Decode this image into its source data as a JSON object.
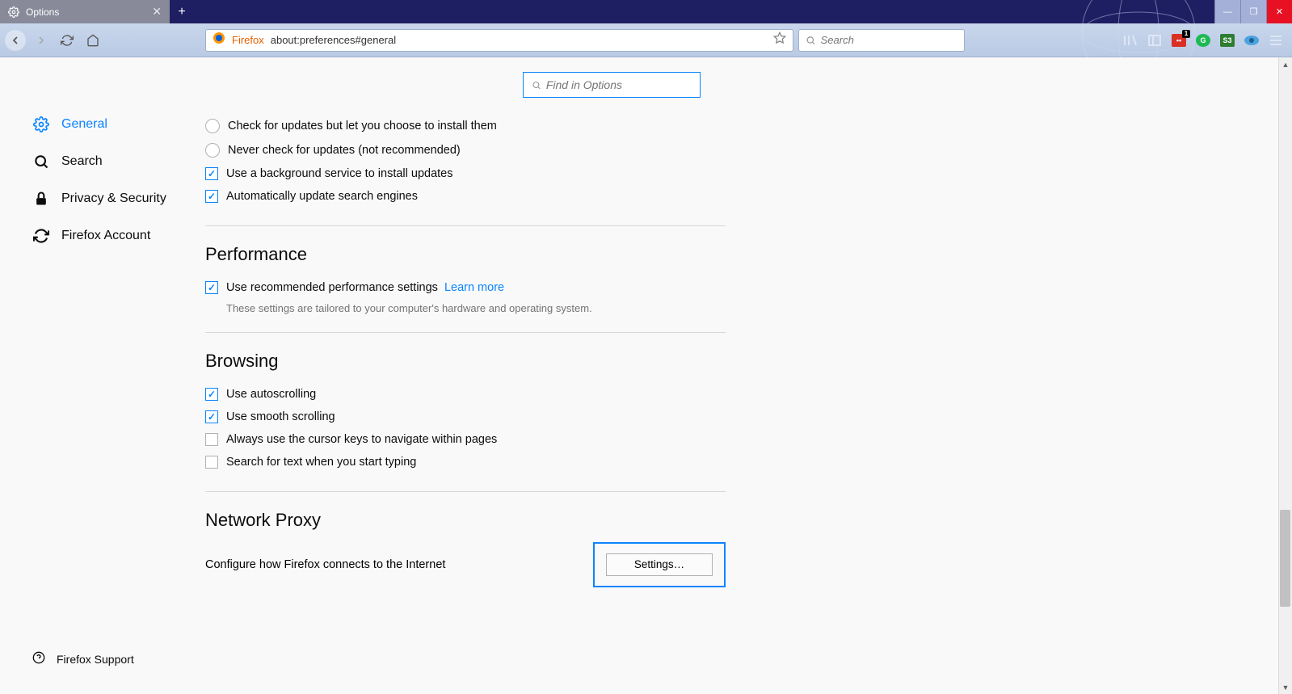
{
  "window": {
    "tab_title": "Options",
    "newtab_badge": "+"
  },
  "toolbar": {
    "firefox_label": "Firefox",
    "url": "about:preferences#general",
    "search_placeholder": "Search",
    "ext_badge": "1"
  },
  "sidebar": {
    "items": [
      {
        "label": "General"
      },
      {
        "label": "Search"
      },
      {
        "label": "Privacy & Security"
      },
      {
        "label": "Firefox Account"
      }
    ],
    "footer": "Firefox Support"
  },
  "find_placeholder": "Find in Options",
  "updates": {
    "radio1": "Check for updates but let you choose to install them",
    "radio2": "Never check for updates (not recommended)",
    "check1": "Use a background service to install updates",
    "check2": "Automatically update search engines"
  },
  "performance": {
    "title": "Performance",
    "check": "Use recommended performance settings",
    "learn": "Learn more",
    "hint": "These settings are tailored to your computer's hardware and operating system."
  },
  "browsing": {
    "title": "Browsing",
    "check1": "Use autoscrolling",
    "check2": "Use smooth scrolling",
    "check3": "Always use the cursor keys to navigate within pages",
    "check4": "Search for text when you start typing"
  },
  "proxy": {
    "title": "Network Proxy",
    "desc": "Configure how Firefox connects to the Internet",
    "button": "Settings…"
  }
}
